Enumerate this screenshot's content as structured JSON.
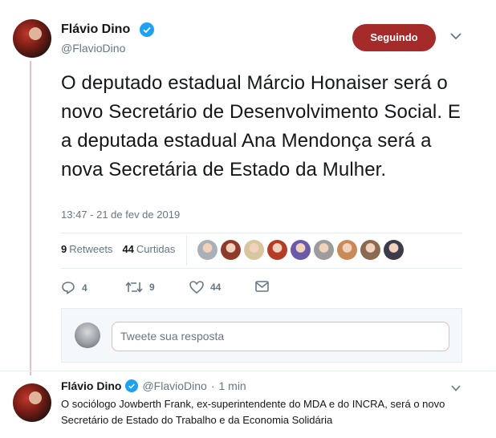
{
  "tweet": {
    "author_name": "Flávio Dino",
    "author_handle": "@FlavioDino",
    "follow_label": "Seguindo",
    "text": "O deputado estadual Márcio Honaiser será o novo Secretário de Desenvolvimento Social. E a deputada estadual Ana Mendonça será a nova Secretária de Estado da Mulher.",
    "timestamp": "13:47 - 21 de fev de 2019",
    "retweets_count": "9",
    "retweets_label": "Retweets",
    "likes_count": "44",
    "likes_label": "Curtidas",
    "actions": {
      "reply_count": "4",
      "retweet_count": "9",
      "like_count": "44"
    }
  },
  "reply": {
    "placeholder": "Tweete sua resposta"
  },
  "next_tweet": {
    "author_name": "Flávio Dino",
    "author_handle": "@FlavioDino",
    "separator": "·",
    "time": "1 min",
    "text": "O sociólogo Jowberth Frank, ex-superintendente do MDA e do INCRA, será o novo Secretário de Estado do Trabalho e da Economia Solidária"
  },
  "colors": {
    "accent": "#a52a2a",
    "verified": "#1da1f2",
    "muted": "#657786",
    "thread_line": "#e1bfc3"
  },
  "liker_faces": [
    "#a9b0b7",
    "#8e3b2b",
    "#d8c6a0",
    "#b53d24",
    "#6b5aa8",
    "#9c9c9c",
    "#c98a5a",
    "#8a6a50",
    "#3b3b4a"
  ]
}
